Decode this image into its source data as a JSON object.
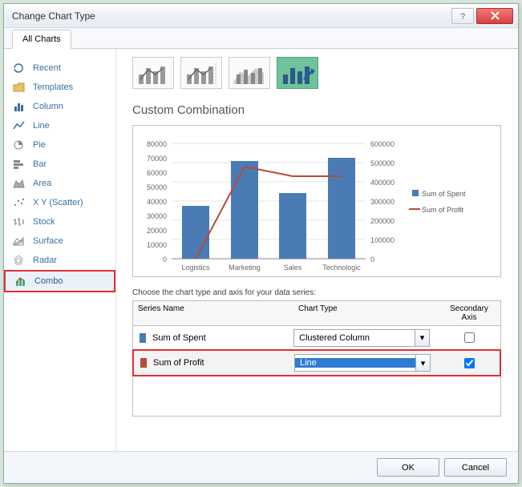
{
  "title": "Change Chart Type",
  "tab": "All Charts",
  "sidebar": {
    "items": [
      {
        "label": "Recent"
      },
      {
        "label": "Templates"
      },
      {
        "label": "Column"
      },
      {
        "label": "Line"
      },
      {
        "label": "Pie"
      },
      {
        "label": "Bar"
      },
      {
        "label": "Area"
      },
      {
        "label": "X Y (Scatter)"
      },
      {
        "label": "Stock"
      },
      {
        "label": "Surface"
      },
      {
        "label": "Radar"
      },
      {
        "label": "Combo"
      }
    ]
  },
  "section_title": "Custom Combination",
  "series_caption": "Choose the chart type and axis for your data series:",
  "series_headers": {
    "name": "Series Name",
    "type": "Chart Type",
    "axis": "Secondary Axis"
  },
  "series": [
    {
      "swatch": "#4a7bb5",
      "name": "Sum of Spent",
      "chart_type": "Clustered Column",
      "secondary": false
    },
    {
      "swatch": "#b84a3a",
      "name": "Sum of Profit",
      "chart_type": "Line",
      "secondary": true
    }
  ],
  "buttons": {
    "ok": "OK",
    "cancel": "Cancel"
  },
  "chart_data": {
    "type": "combo",
    "categories": [
      "Logistics",
      "Marketing",
      "Sales",
      "Technologic"
    ],
    "series": [
      {
        "name": "Sum of Spent",
        "type": "bar",
        "axis": "primary",
        "color": "#4a7bb5",
        "values": [
          37000,
          68000,
          46000,
          70000
        ]
      },
      {
        "name": "Sum of Profit",
        "type": "line",
        "axis": "secondary",
        "color": "#b84a3a",
        "values": [
          0,
          480000,
          430000,
          430000
        ]
      }
    ],
    "ylim_primary": [
      0,
      80000
    ],
    "yticks_primary": [
      0,
      10000,
      20000,
      30000,
      40000,
      50000,
      60000,
      70000,
      80000
    ],
    "ylim_secondary": [
      0,
      600000
    ],
    "yticks_secondary": [
      0,
      100000,
      200000,
      300000,
      400000,
      500000,
      600000
    ],
    "legend": [
      "Sum of Spent",
      "Sum of Profit"
    ]
  }
}
